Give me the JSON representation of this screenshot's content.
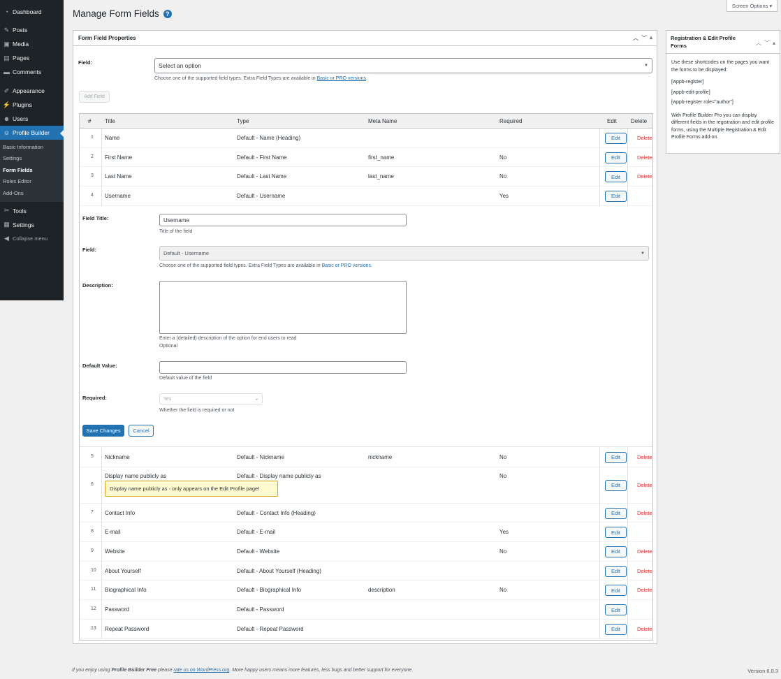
{
  "sidebar": {
    "menu": [
      {
        "label": "Dashboard",
        "icon": "dashboard-icon",
        "glyph": "◔"
      },
      {
        "label": "Posts",
        "icon": "pin-icon",
        "glyph": "✎"
      },
      {
        "label": "Media",
        "icon": "media-icon",
        "glyph": "▣"
      },
      {
        "label": "Pages",
        "icon": "pages-icon",
        "glyph": "▤"
      },
      {
        "label": "Comments",
        "icon": "comments-icon",
        "glyph": "▬"
      },
      {
        "label": "Appearance",
        "icon": "brush-icon",
        "glyph": "✐"
      },
      {
        "label": "Plugins",
        "icon": "plugin-icon",
        "glyph": "⚡"
      },
      {
        "label": "Users",
        "icon": "users-icon",
        "glyph": "☻"
      },
      {
        "label": "Profile Builder",
        "icon": "profile-builder-icon",
        "glyph": "☺"
      },
      {
        "label": "Tools",
        "icon": "tools-icon",
        "glyph": "✂"
      },
      {
        "label": "Settings",
        "icon": "settings-icon",
        "glyph": "▦"
      },
      {
        "label": "Collapse menu",
        "icon": "collapse-icon",
        "glyph": "◀"
      }
    ],
    "submenu": [
      "Basic Information",
      "Settings",
      "Form Fields",
      "Roles Editor",
      "Add-Ons"
    ]
  },
  "header": {
    "title": "Manage Form Fields",
    "help": "?",
    "screen_options": "Screen Options ▾"
  },
  "main_panel": {
    "title": "Form Field Properties",
    "field_label": "Field:",
    "field_select": "Select an option",
    "field_hint_pre": "Choose one of the supported field types. Extra Field Types are available in ",
    "field_hint_link": "Basic or PRO versions",
    "field_hint_post": ".",
    "add_field": "Add Field"
  },
  "table": {
    "headers": {
      "num": "#",
      "title": "Title",
      "type": "Type",
      "meta": "Meta Name",
      "required": "Required",
      "edit": "Edit",
      "delete": "Delete"
    },
    "edit_label": "Edit",
    "delete_label": "Delete",
    "rows_top": [
      {
        "num": "1",
        "title": "Name",
        "type": "Default - Name (Heading)",
        "meta": "",
        "required": "",
        "delete": true
      },
      {
        "num": "2",
        "title": "First Name",
        "type": "Default - First Name",
        "meta": "first_name",
        "required": "No",
        "delete": true
      },
      {
        "num": "3",
        "title": "Last Name",
        "type": "Default - Last Name",
        "meta": "last_name",
        "required": "No",
        "delete": true
      },
      {
        "num": "4",
        "title": "Username",
        "type": "Default - Username",
        "meta": "",
        "required": "Yes",
        "delete": false
      }
    ],
    "rows_bottom": [
      {
        "num": "5",
        "title": "Nickname",
        "type": "Default - Nickname",
        "meta": "nickname",
        "required": "No",
        "delete": true
      },
      {
        "num": "6",
        "title": "Display name publicly as",
        "type": "Default - Display name publicly as",
        "meta": "",
        "required": "No",
        "delete": true,
        "tooltip": "Display name publicly as - only appears on the Edit Profile page!"
      },
      {
        "num": "7",
        "title": "Contact Info",
        "type": "Default - Contact Info (Heading)",
        "meta": "",
        "required": "",
        "delete": true
      },
      {
        "num": "8",
        "title": "E-mail",
        "type": "Default - E-mail",
        "meta": "",
        "required": "Yes",
        "delete": false
      },
      {
        "num": "9",
        "title": "Website",
        "type": "Default - Website",
        "meta": "",
        "required": "No",
        "delete": true
      },
      {
        "num": "10",
        "title": "About Yourself",
        "type": "Default - About Yourself (Heading)",
        "meta": "",
        "required": "",
        "delete": true
      },
      {
        "num": "11",
        "title": "Biographical Info",
        "type": "Default - Biographical Info",
        "meta": "description",
        "required": "No",
        "delete": true
      },
      {
        "num": "12",
        "title": "Password",
        "type": "Default - Password",
        "meta": "",
        "required": "",
        "delete": false
      },
      {
        "num": "13",
        "title": "Repeat Password",
        "type": "Default - Repeat Password",
        "meta": "",
        "required": "",
        "delete": true
      }
    ]
  },
  "edit_form": {
    "field_title_label": "Field Title:",
    "field_title_value": "Username",
    "field_title_hint": "Title of the field",
    "field_label": "Field:",
    "field_value": "Default - Username",
    "field_hint_pre": "Choose one of the supported field types. Extra Field Types are available in ",
    "field_hint_link": "Basic or PRO versions",
    "field_hint_post": ".",
    "description_label": "Description:",
    "description_hint": "Enter a (detailed) description of the option for end users to read",
    "description_hint2": "Optional",
    "default_label": "Default Value:",
    "default_hint": "Default value of the field",
    "required_label": "Required:",
    "required_value": "Yes",
    "required_hint": "Whether the field is required or not",
    "save": "Save Changes",
    "cancel": "Cancel"
  },
  "side_panel": {
    "title": "Registration & Edit Profile Forms",
    "intro": "Use these shortcodes on the pages you want the forms to be displayed:",
    "shortcodes": [
      "[wppb-register]",
      "[wppb-edit-profile]",
      "[wppb-register role=\"author\"]"
    ],
    "outro": "With Profile Builder Pro you can display different fields in the registration and edit profile forms, using the Multiple Registration & Edit Profile Forms add-on."
  },
  "footer": {
    "pre": "If you enjoy using ",
    "brand": "Profile Builder Free",
    "mid": " please ",
    "link": "rate us on WordPress.org",
    "post": ". More happy users means more features, less bugs and better support for everyone.",
    "version": "Version 6.0.3"
  }
}
